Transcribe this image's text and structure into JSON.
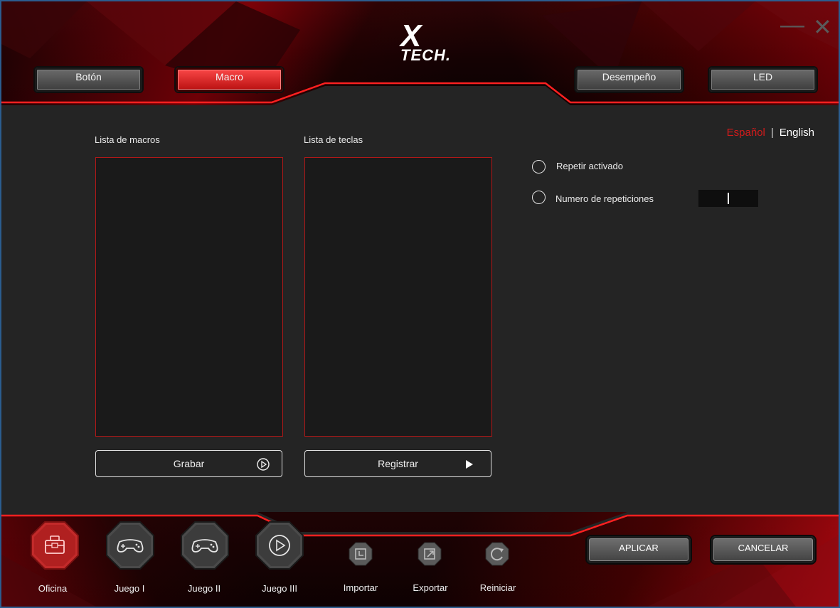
{
  "header": {
    "logo_x": "X",
    "logo_tech": "TECH.",
    "tabs": [
      {
        "label": "Botón",
        "active": false
      },
      {
        "label": "Macro",
        "active": true
      },
      {
        "label": "Desempeño",
        "active": false
      },
      {
        "label": "LED",
        "active": false
      }
    ],
    "minimize_icon": "minimize-icon",
    "close_icon": "close-icon"
  },
  "language": {
    "spanish": "Español",
    "separator": "|",
    "english": "English",
    "active": "Español"
  },
  "macro_panel": {
    "macro_list_label": "Lista de macros",
    "key_list_label": "Lista de teclas",
    "record_button": "Grabar",
    "register_button": "Registrar"
  },
  "options": {
    "repeat_label": "Repetir activado",
    "repeat_count_label": "Numero de repeticiones",
    "repeat_count_value": ""
  },
  "footer": {
    "modes": [
      {
        "label": "Oficina",
        "icon": "toolbox-icon",
        "active": true
      },
      {
        "label": "Juego I",
        "icon": "gamepad-icon",
        "active": false
      },
      {
        "label": "Juego II",
        "icon": "gamepad-icon",
        "active": false
      },
      {
        "label": "Juego III",
        "icon": "play-icon",
        "active": false
      }
    ],
    "tools": [
      {
        "label": "Importar",
        "icon": "import-icon"
      },
      {
        "label": "Exportar",
        "icon": "export-icon"
      },
      {
        "label": "Reiniciar",
        "icon": "reset-icon"
      }
    ],
    "apply_button": "APLICAR",
    "cancel_button": "CANCELAR"
  },
  "colors": {
    "accent": "#d21b1b",
    "background": "#242424",
    "list_border": "#b01818"
  }
}
